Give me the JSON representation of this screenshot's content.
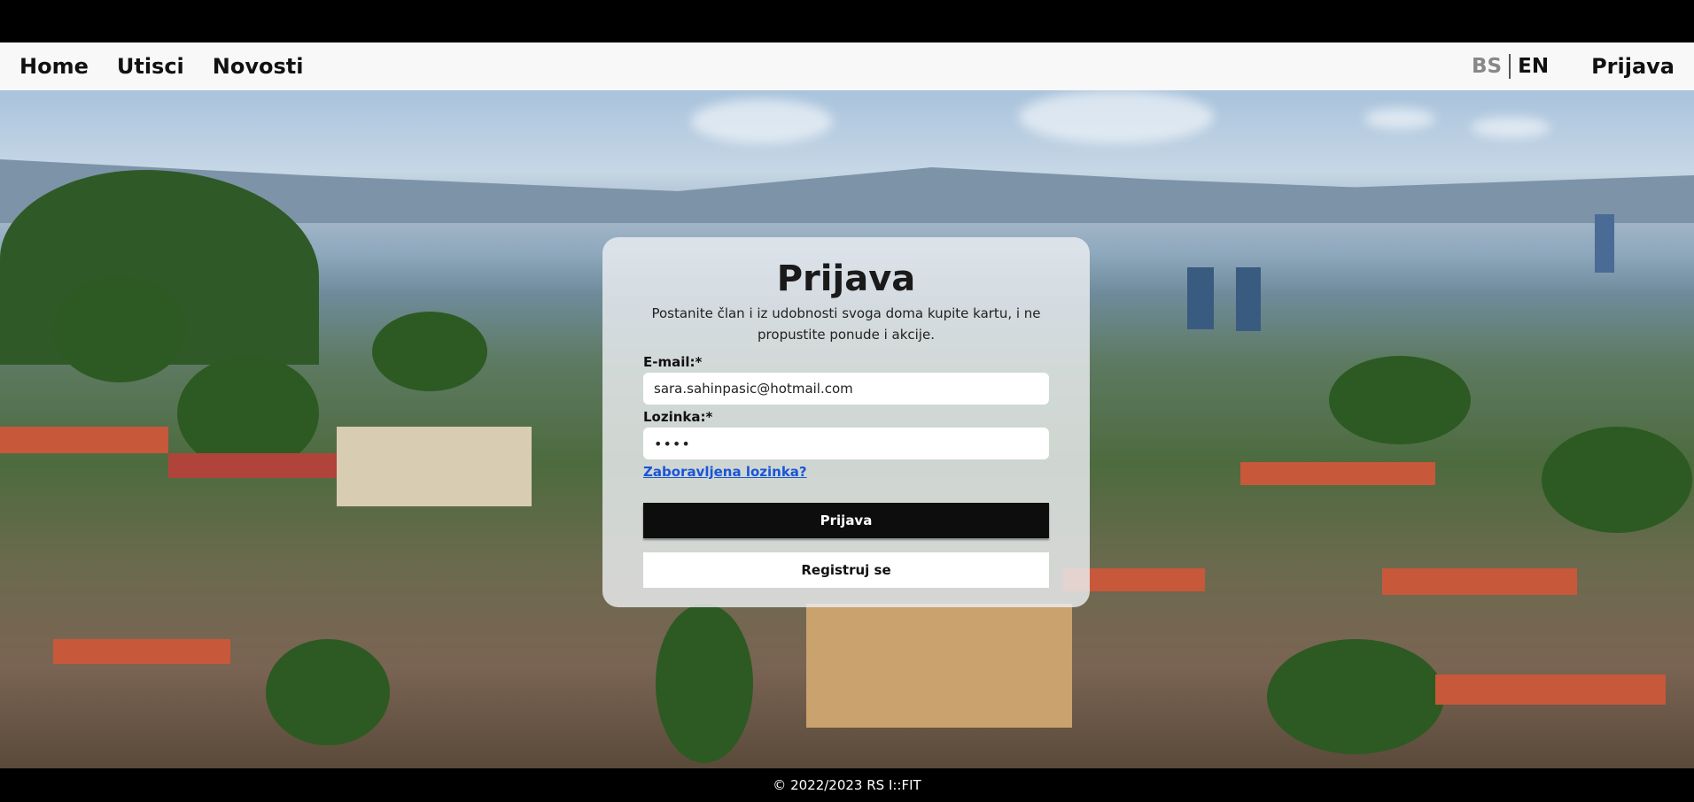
{
  "nav": {
    "links": [
      "Home",
      "Utisci",
      "Novosti"
    ],
    "lang_bs": "BS",
    "lang_en": "EN",
    "login": "Prijava"
  },
  "login": {
    "title": "Prijava",
    "subtitle": "Postanite član i iz udobnosti svoga doma kupite kartu, i ne propustite ponude i akcije.",
    "email_label": "E-mail:*",
    "email_value": "sara.sahinpasic@hotmail.com",
    "password_label": "Lozinka:*",
    "password_value": "••••",
    "forgot": "Zaboravljena lozinka?",
    "submit": "Prijava",
    "register": "Registruj se"
  },
  "footer": {
    "text": "© 2022/2023 RS I::FIT"
  },
  "colors": {
    "navbar_bg": "#f8f8f8",
    "primary_button": "#0d0d0d",
    "link": "#1a55d8"
  }
}
